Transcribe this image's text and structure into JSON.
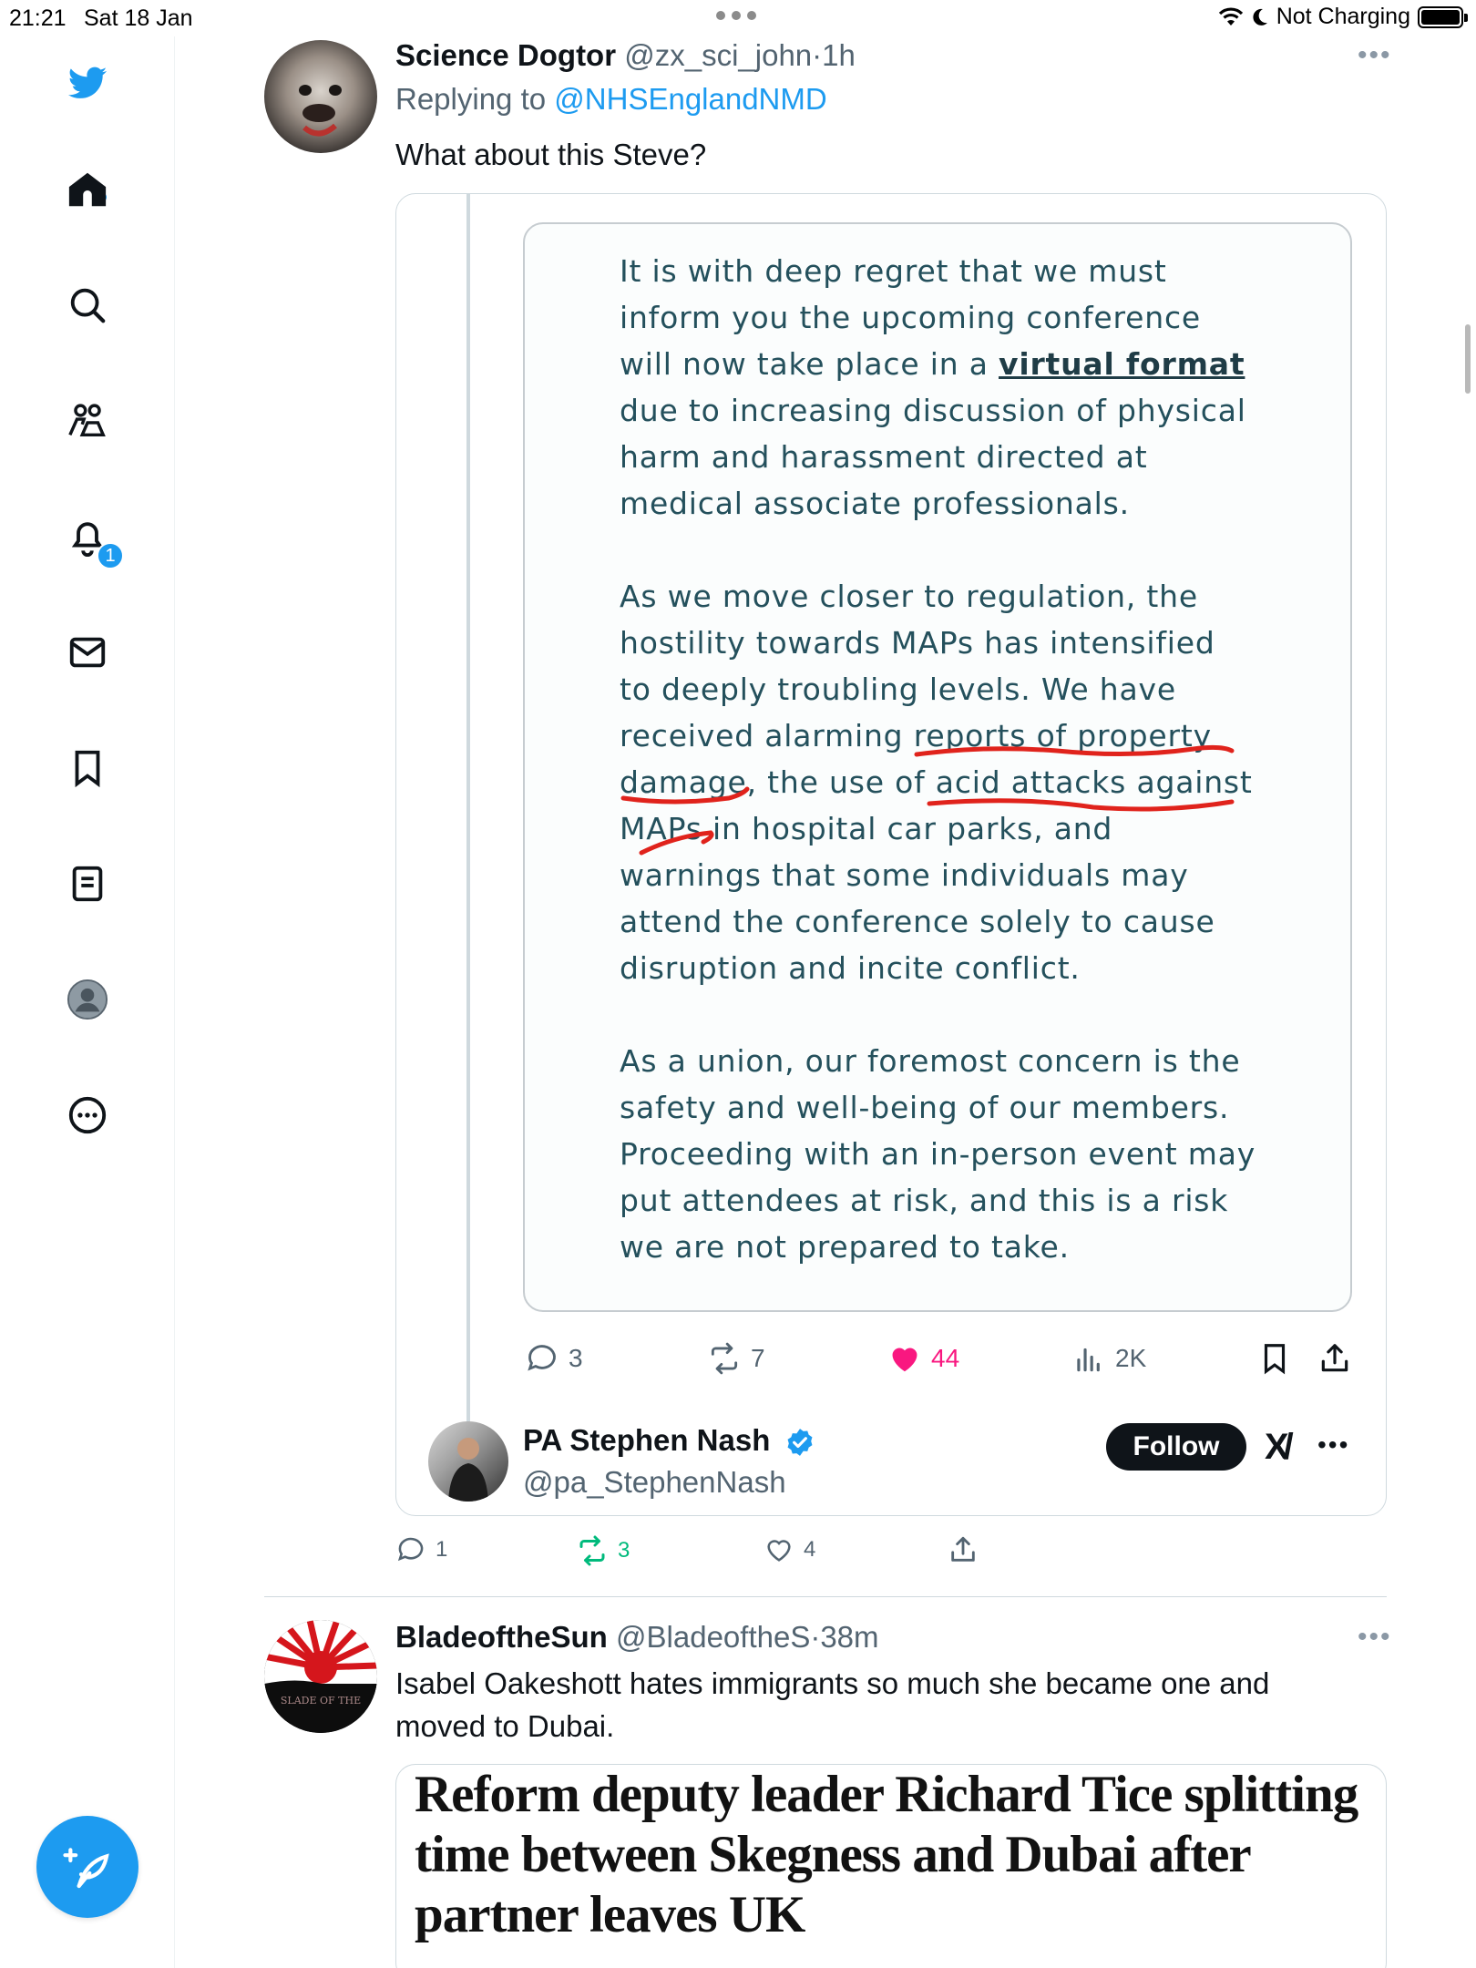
{
  "status_bar": {
    "time": "21:21",
    "date": "Sat 18 Jan",
    "charging": "Not Charging"
  },
  "sidebar": {
    "items": [
      {
        "icon": "twitter-bird-icon"
      },
      {
        "icon": "home-icon"
      },
      {
        "icon": "search-icon"
      },
      {
        "icon": "communities-icon"
      },
      {
        "icon": "notifications-icon"
      },
      {
        "icon": "messages-icon"
      },
      {
        "icon": "bookmarks-icon"
      },
      {
        "icon": "lists-icon"
      },
      {
        "icon": "profile-icon"
      },
      {
        "icon": "more-icon"
      }
    ],
    "notification_count": "1",
    "compose_icon": "compose-icon"
  },
  "tweet1": {
    "display_name": "Science Dogtor",
    "handle": "@zx_sci_john",
    "separator": "·",
    "time": "1h",
    "replying_prefix": "Replying to",
    "replying_to": "@NHSEnglandNMD",
    "text": "What about this Steve?",
    "quote": {
      "image_lines": [
        "It is with deep regret that we must",
        "inform you the upcoming conference",
        "will now take place in a ",
        "virtual format",
        "due to increasing discussion of physical",
        "harm and harassment directed at",
        "medical associate professionals.",
        "As we move closer to regulation, the",
        "hostility towards MAPs has intensified",
        "to deeply troubling levels. We have",
        "received alarming reports of property",
        "damage, the use of acid attacks against",
        "MAPs in hospital car parks, and",
        "warnings that some individuals may",
        "attend the conference solely to cause",
        "disruption and incite conflict.",
        "As a union, our foremost concern is the",
        "safety and well-being of our members.",
        "Proceeding with an in-person event may",
        "put attendees at risk, and this is a risk",
        "we are not prepared to take."
      ],
      "stats": {
        "replies": "3",
        "retweets": "7",
        "likes": "44",
        "views": "2K"
      },
      "author_name": "PA Stephen Nash",
      "author_handle": "@pa_StephenNash",
      "follow_label": "Follow",
      "brand_mark": "X/"
    },
    "stats": {
      "replies": "1",
      "retweets": "3",
      "likes": "4"
    }
  },
  "tweet2": {
    "display_name": "BladeoftheSun",
    "handle": "@BladeoftheS",
    "separator": "·",
    "time": "38m",
    "text_line1": "Isabel Oakeshott hates immigrants so much she became one and",
    "text_line2": "moved to Dubai.",
    "avatar_text": "SLADE OF THE",
    "card_headline": "Reform deputy leader Richard Tice splitting time between Skegness and Dubai after partner leaves UK"
  },
  "colors": {
    "accent": "#1d9bf0",
    "like": "#f91880",
    "retweet_active": "#00ba7c",
    "muted": "#536471",
    "image_text": "#24505c",
    "scribble": "#e0231c"
  }
}
